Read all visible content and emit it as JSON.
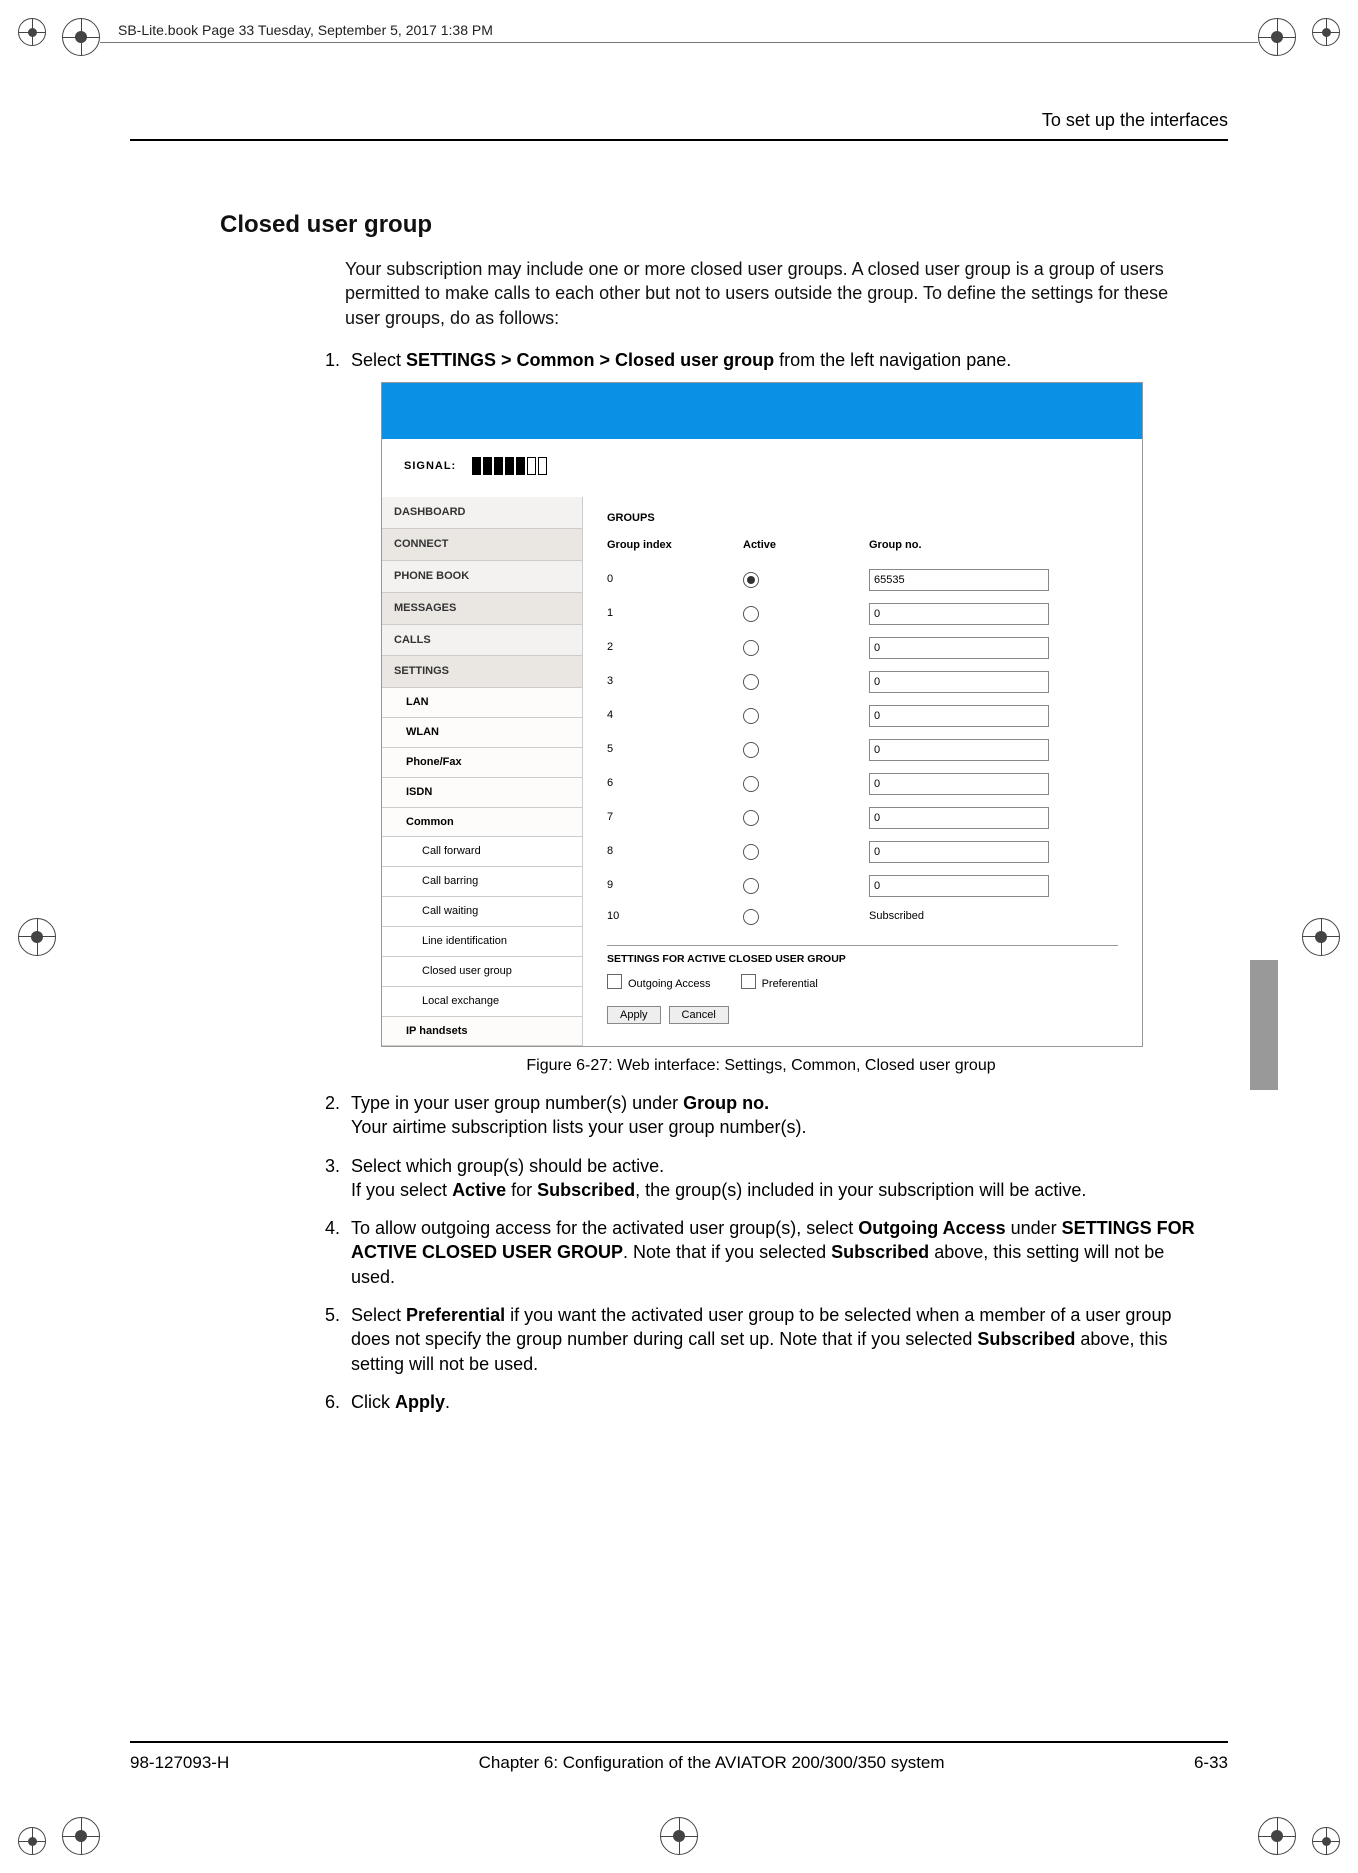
{
  "frame_header": "SB-Lite.book  Page 33  Tuesday, September 5, 2017  1:38 PM",
  "running_head": "To set up the interfaces",
  "heading": "Closed user group",
  "intro": "Your subscription may include one or more closed user groups. A closed user group is a group of users permitted to make calls to each other but not to users outside the group. To define the settings for these user groups, do as follows:",
  "step1_pre": "Select ",
  "step1_bold": "SETTINGS > Common > Closed user group",
  "step1_post": " from the left navigation pane.",
  "figure_caption": "Figure 6-27: Web interface: Settings, Common, Closed user group",
  "step2_pre": "Type in your user group number(s) under ",
  "step2_bold": "Group no.",
  "step2_tail": "Your airtime subscription lists your user group number(s).",
  "step3_l1": "Select which group(s) should be active.",
  "step3_l2a": "If you select ",
  "step3_l2b": "Active",
  "step3_l2c": " for ",
  "step3_l2d": "Subscribed",
  "step3_l2e": ", the group(s) included in your subscription will be active.",
  "step4_a": "To allow outgoing access for the activated user group(s), select ",
  "step4_b": "Outgoing Access",
  "step4_c": " under ",
  "step4_d": "SETTINGS FOR ACTIVE CLOSED USER GROUP",
  "step4_e": ". Note that if you selected ",
  "step4_f": "Subscribed",
  "step4_g": " above, this setting will not be used.",
  "step5_a": "Select ",
  "step5_b": "Preferential",
  "step5_c": " if you want the activated user group to be selected when a member of a user group does not specify the group number during call set up. Note that if you selected ",
  "step5_d": "Subscribed",
  "step5_e": " above, this setting will not be used.",
  "step6_a": "Click ",
  "step6_b": "Apply",
  "step6_c": ".",
  "webui": {
    "signal_label": "SIGNAL:",
    "nav": {
      "dashboard": "DASHBOARD",
      "connect": "CONNECT",
      "phonebook": "PHONE BOOK",
      "messages": "MESSAGES",
      "calls": "CALLS",
      "settings": "SETTINGS",
      "lan": "LAN",
      "wlan": "WLAN",
      "phonefax": "Phone/Fax",
      "isdn": "ISDN",
      "common": "Common",
      "call_forward": "Call forward",
      "call_barring": "Call barring",
      "call_waiting": "Call waiting",
      "line_id": "Line identification",
      "cug": "Closed user group",
      "local_ex": "Local exchange",
      "ip_handsets": "IP handsets"
    },
    "groups_title": "GROUPS",
    "th_index": "Group index",
    "th_active": "Active",
    "th_groupno": "Group no.",
    "rows": [
      {
        "idx": "0",
        "active": true,
        "val": "65535"
      },
      {
        "idx": "1",
        "active": false,
        "val": "0"
      },
      {
        "idx": "2",
        "active": false,
        "val": "0"
      },
      {
        "idx": "3",
        "active": false,
        "val": "0"
      },
      {
        "idx": "4",
        "active": false,
        "val": "0"
      },
      {
        "idx": "5",
        "active": false,
        "val": "0"
      },
      {
        "idx": "6",
        "active": false,
        "val": "0"
      },
      {
        "idx": "7",
        "active": false,
        "val": "0"
      },
      {
        "idx": "8",
        "active": false,
        "val": "0"
      },
      {
        "idx": "9",
        "active": false,
        "val": "0"
      }
    ],
    "row10_idx": "10",
    "row10_label": "Subscribed",
    "section2": "SETTINGS FOR ACTIVE CLOSED USER GROUP",
    "chk_outgoing": "Outgoing Access",
    "chk_pref": "Preferential",
    "btn_apply": "Apply",
    "btn_cancel": "Cancel"
  },
  "footer": {
    "left": "98-127093-H",
    "center": "Chapter 6:  Configuration of the AVIATOR 200/300/350 system",
    "right": "6-33"
  }
}
